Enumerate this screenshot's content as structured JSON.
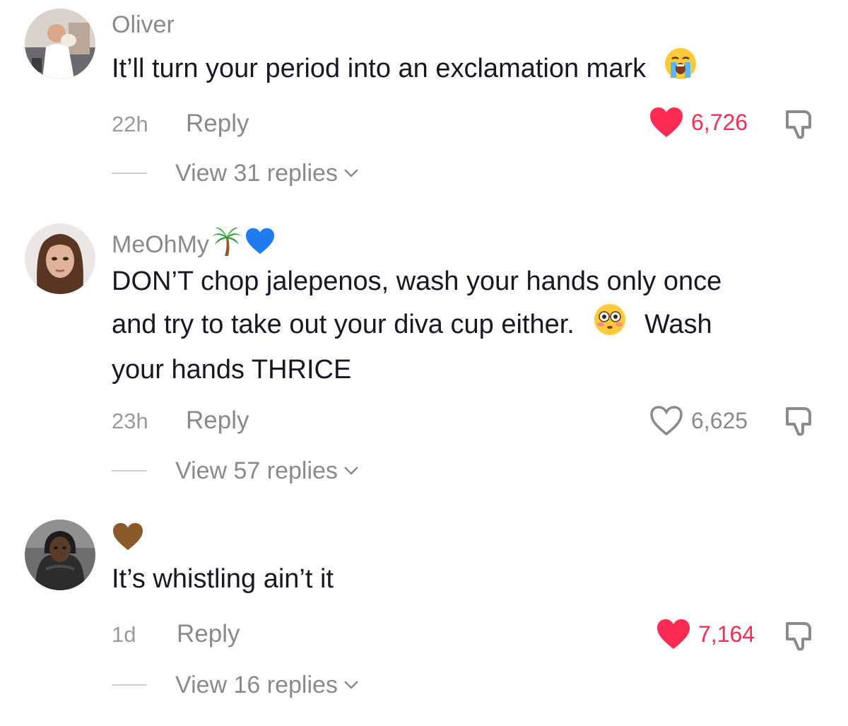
{
  "comments": [
    {
      "username": "Oliver",
      "text": "It’ll turn your period into an exclamation mark",
      "text_emoji": "loudly-crying-face-emoji",
      "time": "22h",
      "reply_label": "Reply",
      "likes": "6,726",
      "liked": true,
      "view_replies": "View 31 replies"
    },
    {
      "username": "MeOhMy",
      "username_emojis": [
        "palm-tree-emoji",
        "blue-heart-emoji"
      ],
      "text_line1": "DON’T chop jalepenos, wash your hands only once",
      "text_line2a": "and try to take out your diva cup either.",
      "text_line2b": "Wash",
      "text_line3": "your hands THRICE",
      "text_emoji": "flushed-face-emoji",
      "time": "23h",
      "reply_label": "Reply",
      "likes": "6,625",
      "liked": false,
      "view_replies": "View 57 replies"
    },
    {
      "username": "",
      "username_emojis": [
        "brown-heart-emoji"
      ],
      "text": "It’s whistling ain’t it",
      "time": "1d",
      "reply_label": "Reply",
      "likes": "7,164",
      "liked": true,
      "view_replies": "View 16 replies"
    }
  ],
  "colors": {
    "like_active": "#fe2c55",
    "muted": "#8a8a8a",
    "text": "#161823",
    "brown_heart": "#8b5a2b",
    "blue_heart": "#1e7bf0"
  }
}
